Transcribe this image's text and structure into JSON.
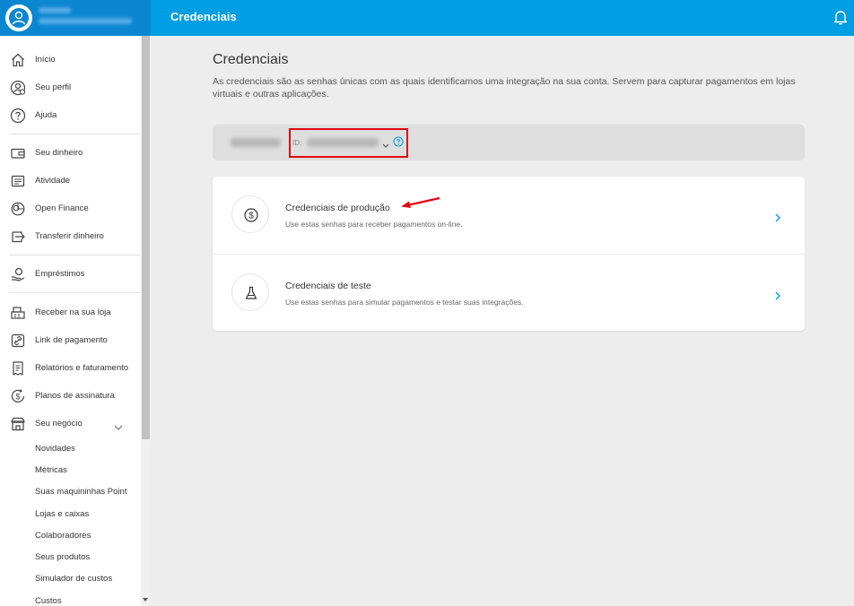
{
  "header": {
    "title": "Credenciais",
    "user_name": "",
    "user_subtitle": "",
    "brand_color": "#009ee3"
  },
  "sidebar": {
    "items": [
      {
        "label": "Início",
        "icon": "home-icon"
      },
      {
        "label": "Seu perfil",
        "icon": "profile-icon"
      },
      {
        "label": "Ajuda",
        "icon": "help-icon"
      },
      {
        "label": "Seu dinheiro",
        "icon": "wallet-icon"
      },
      {
        "label": "Atividade",
        "icon": "activity-icon"
      },
      {
        "label": "Open Finance",
        "icon": "open-finance-icon"
      },
      {
        "label": "Transferir dinheiro",
        "icon": "transfer-icon"
      },
      {
        "label": "Empréstimos",
        "icon": "loan-icon"
      },
      {
        "label": "Receber na sua loja",
        "icon": "register-icon"
      },
      {
        "label": "Link de pagamento",
        "icon": "link-icon"
      },
      {
        "label": "Relatórios e faturamento",
        "icon": "report-icon"
      },
      {
        "label": "Planos de assinatura",
        "icon": "subscription-icon"
      },
      {
        "label": "Seu negócio",
        "icon": "store-icon"
      }
    ],
    "sub_items": [
      "Novidades",
      "Métricas",
      "Suas maquininhas Point",
      "Lojas e caixas",
      "Colaboradores",
      "Seus produtos",
      "Simulador de custos",
      "Custos"
    ]
  },
  "main": {
    "title": "Credenciais",
    "description": "As credenciais são as senhas únicas com as quais identificamos uma integração na sua conta. Servem para capturar pagamentos em lojas virtuais e outras aplicações.",
    "account": {
      "id_label": "ID:"
    },
    "options": [
      {
        "title": "Credenciais de produção",
        "subtitle": "Use estas senhas para receber pagamentos on-line.",
        "icon": "dollar-icon"
      },
      {
        "title": "Credenciais de teste",
        "subtitle": "Use estas senhas para simular pagamentos e testar suas integrações.",
        "icon": "flask-icon"
      }
    ]
  },
  "colors": {
    "highlight": "#e30613",
    "chevron": "#009ee3"
  }
}
